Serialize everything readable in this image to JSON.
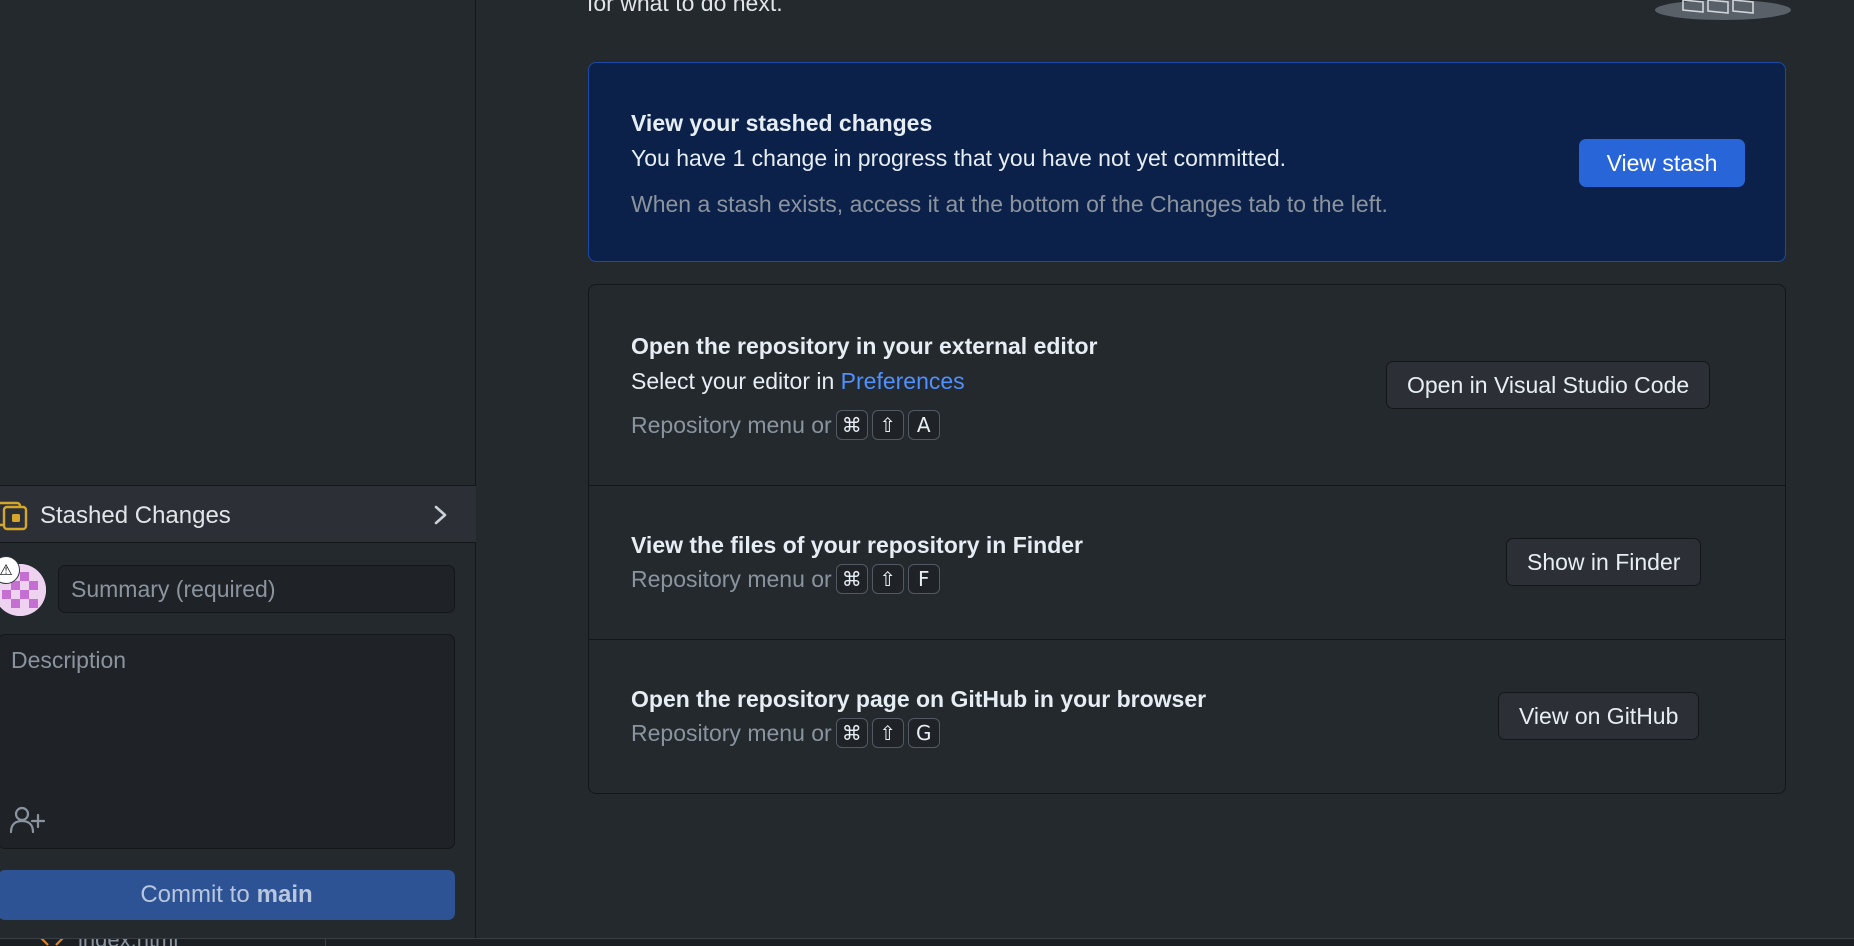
{
  "sidebar": {
    "stashed_changes_label": "Stashed Changes",
    "summary_placeholder": "Summary (required)",
    "description_placeholder": "Description",
    "commit_prefix": "Commit to",
    "commit_branch": "main",
    "avatar_warning": "⚠",
    "file_tab_label": "index.html"
  },
  "main": {
    "top_text": "for what to do next.",
    "stash_card": {
      "title": "View your stashed changes",
      "body": "You have 1 change in progress that you have not yet committed.",
      "hint": "When a stash exists, access it at the bottom of the Changes tab to the left.",
      "button_label": "View stash"
    },
    "actions": [
      {
        "title": "Open the repository in your external editor",
        "body_prefix": "Select your editor in",
        "body_link": "Preferences",
        "shortcut_prefix": "Repository menu or",
        "keys": [
          "⌘",
          "⇧",
          "A"
        ],
        "button_label": "Open in Visual Studio Code"
      },
      {
        "title": "View the files of your repository in Finder",
        "shortcut_prefix": "Repository menu or",
        "keys": [
          "⌘",
          "⇧",
          "F"
        ],
        "button_label": "Show in Finder"
      },
      {
        "title": "Open the repository page on GitHub in your browser",
        "shortcut_prefix": "Repository menu or",
        "keys": [
          "⌘",
          "⇧",
          "G"
        ],
        "button_label": "View on GitHub"
      }
    ]
  },
  "colors": {
    "background": "#24292e",
    "stash_card_bg": "#0c2149",
    "accent_blue": "#2865d8",
    "link_blue": "#4f90ff",
    "commit_button": "#2d5394",
    "stash_icon": "#d4a72c"
  },
  "icons": {
    "stash": "stack-icon",
    "chevron": "chevron-right-icon",
    "coauthor": "add-person-icon",
    "warning": "warning-icon",
    "file": "code-icon"
  }
}
